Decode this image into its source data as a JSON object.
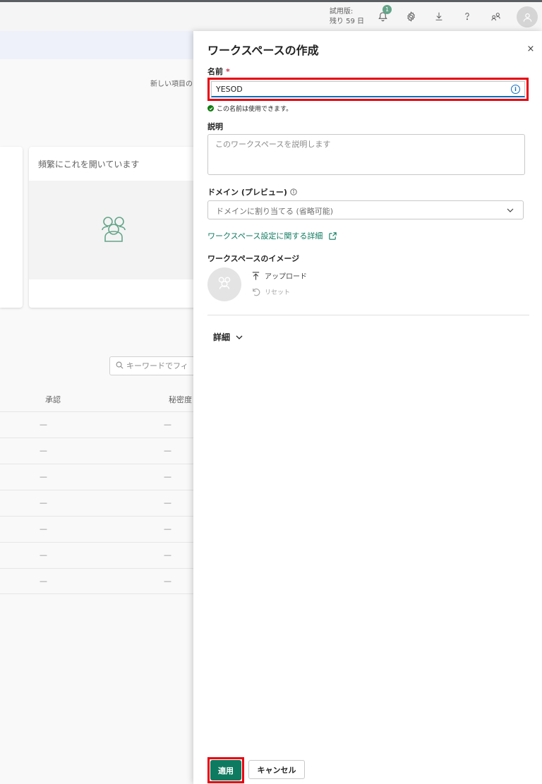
{
  "topbar": {
    "trial_line1": "試用版:",
    "trial_line2": "残り 59 日",
    "notification_count": "1"
  },
  "background": {
    "new_item_text": "新しい項目の",
    "card_title": "頻繁にこれを開いています",
    "filter_placeholder": "キーワードでフィ",
    "columns": [
      "承認",
      "秘密度"
    ],
    "rows": [
      [
        "—",
        "—"
      ],
      [
        "—",
        "—"
      ],
      [
        "—",
        "—"
      ],
      [
        "—",
        "—"
      ],
      [
        "—",
        "—"
      ],
      [
        "—",
        "—"
      ],
      [
        "—",
        "—"
      ]
    ]
  },
  "panel": {
    "title": "ワークスペースの作成",
    "close_label": "×",
    "name_label": "名前",
    "required_mark": "*",
    "name_value": "YESOD",
    "name_valid_message": "この名前は使用できます。",
    "description_label": "説明",
    "description_placeholder": "このワークスペースを説明します",
    "domain_label": "ドメイン (プレビュー)",
    "domain_placeholder": "ドメインに割り当てる (省略可能)",
    "settings_link": "ワークスペース設定に関する詳細",
    "image_label": "ワークスペースのイメージ",
    "upload_label": "アップロード",
    "reset_label": "リセット",
    "details_label": "詳細",
    "apply_label": "適用",
    "cancel_label": "キャンセル"
  },
  "colors": {
    "accent": "#0e7a5f",
    "highlight": "#e8000f",
    "link": "#0e7a5f"
  }
}
